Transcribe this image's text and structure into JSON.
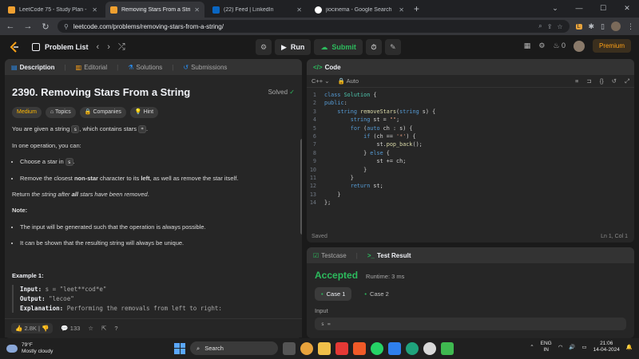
{
  "browser": {
    "tabs": [
      {
        "title": "LeetCode 75 - Study Plan - Leet",
        "favicon_color": "#f0a030",
        "active": false
      },
      {
        "title": "Removing Stars From a String",
        "favicon_color": "#f0a030",
        "active": true
      },
      {
        "title": "(22) Feed | LinkedIn",
        "favicon_color": "#0a66c2",
        "active": false
      },
      {
        "title": "jiocinema - Google Search",
        "favicon_color": "#ffffff",
        "active": false
      }
    ],
    "url": "leetcode.com/problems/removing-stars-from-a-string/"
  },
  "header": {
    "problem_list": "Problem List",
    "run": "Run",
    "submit": "Submit",
    "streak": "0",
    "premium": "Premium"
  },
  "description": {
    "tabs": [
      "Description",
      "Editorial",
      "Solutions",
      "Submissions"
    ],
    "title": "2390. Removing Stars From a String",
    "solved": "Solved",
    "tags": [
      "Medium",
      "Topics",
      "Companies",
      "Hint"
    ],
    "p1_a": "You are given a string ",
    "p1_code1": "s",
    "p1_b": ", which contains stars ",
    "p1_code2": "*",
    "p1_c": ".",
    "p2": "In one operation, you can:",
    "li1_a": "Choose a star in ",
    "li1_code": "s",
    "li1_b": ".",
    "li2_a": "Remove the closest ",
    "li2_b": "non-star",
    "li2_c": " character to its ",
    "li2_d": "left",
    "li2_e": ", as well as remove the star itself.",
    "p3_a": "Return ",
    "p3_b": "the string after ",
    "p3_c": "all",
    "p3_d": " stars have been removed",
    "p3_e": ".",
    "note": "Note:",
    "note1": "The input will be generated such that the operation is always possible.",
    "note2": "It can be shown that the resulting string will always be unique.",
    "example_title": "Example 1:",
    "ex_input_label": "Input:",
    "ex_input_value": "s = \"leet**cod*e\"",
    "ex_output_label": "Output:",
    "ex_output_value": "\"lecoe\"",
    "ex_expl_label": "Explanation:",
    "ex_expl_value": "Performing the removals from left to right:",
    "likes": "2.8K",
    "comments": "133"
  },
  "code": {
    "title": "Code",
    "language": "C++",
    "mode": "Auto",
    "lines": [
      "class Solution {",
      "public:",
      "    string removeStars(string s) {",
      "        string st = \"\";",
      "        for (auto ch : s) {",
      "            if (ch == '*') {",
      "                st.pop_back();",
      "            } else {",
      "                st += ch;",
      "            }",
      "        }",
      "        return st;",
      "    }",
      "};"
    ],
    "saved": "Saved",
    "cursor": "Ln 1, Col 1"
  },
  "result": {
    "tabs": [
      "Testcase",
      "Test Result"
    ],
    "status": "Accepted",
    "runtime": "Runtime: 3 ms",
    "cases": [
      "Case 1",
      "Case 2"
    ],
    "input_label": "Input",
    "input_preview": "s ="
  },
  "taskbar": {
    "temp": "79°F",
    "weather": "Mostly cloudy",
    "search": "Search",
    "lang1": "ENG",
    "lang2": "IN",
    "time": "21:06",
    "date": "14-04-2024"
  }
}
